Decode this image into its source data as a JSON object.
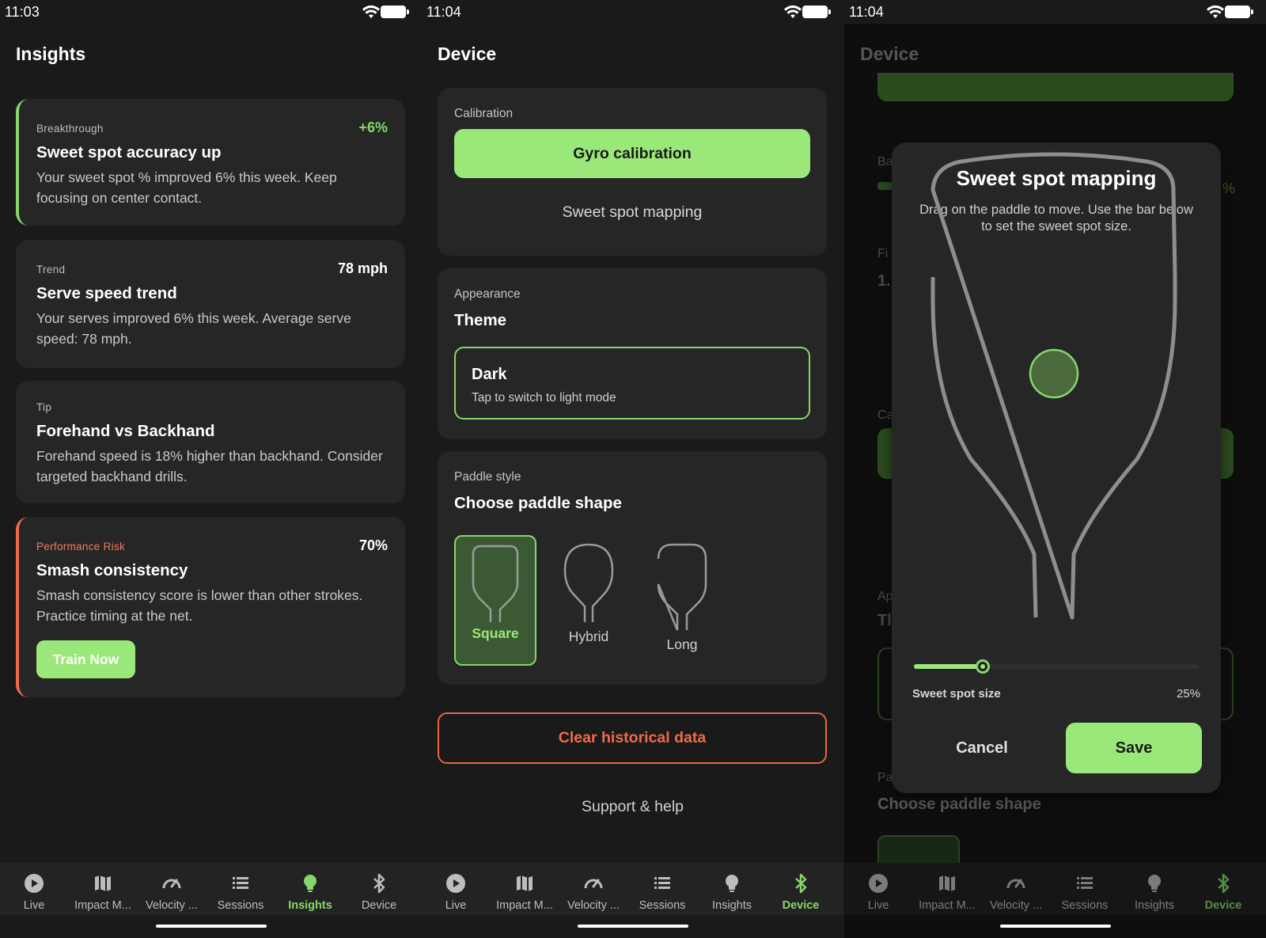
{
  "colors": {
    "accent": "#86d66a",
    "accent_button": "#9be87a",
    "danger": "#ef6b4b",
    "background": "#1a1a1a",
    "card": "#262626"
  },
  "screens": [
    {
      "time": "11:03",
      "title": "Insights",
      "cards": [
        {
          "category": "Breakthrough",
          "metric": "+6%",
          "title": "Sweet spot accuracy up",
          "description": "Your sweet spot % improved 6% this week. Keep focusing on center contact."
        },
        {
          "category": "Trend",
          "metric": "78 mph",
          "title": "Serve speed trend",
          "description": "Your serves improved 6% this week. Average serve speed: 78 mph."
        },
        {
          "category": "Tip",
          "metric": "",
          "title": "Forehand vs Backhand",
          "description": "Forehand speed is 18% higher than backhand. Consider targeted backhand drills."
        },
        {
          "category": "Performance Risk",
          "metric": "70%",
          "title": "Smash consistency",
          "description": "Smash consistency score is lower than other strokes. Practice timing at the net.",
          "action": "Train Now"
        }
      ]
    },
    {
      "time": "11:04",
      "title": "Device",
      "calibration": {
        "label": "Calibration",
        "gyro_button": "Gyro calibration",
        "sweet_spot_link": "Sweet spot mapping"
      },
      "appearance": {
        "label": "Appearance",
        "heading": "Theme",
        "value": "Dark",
        "hint": "Tap to switch to light mode"
      },
      "paddle": {
        "label": "Paddle style",
        "heading": "Choose paddle shape",
        "options": [
          "Square",
          "Hybrid",
          "Long"
        ],
        "selected": "Square"
      },
      "clear_button": "Clear historical data",
      "support_link": "Support & help"
    },
    {
      "time": "11:04",
      "title": "Device",
      "background_fragments": [
        "Ba",
        "%",
        "Fi",
        "1.",
        "Ca",
        "Ap",
        "Tl",
        "Pa"
      ],
      "background_heading": "Choose paddle shape",
      "modal": {
        "title": "Sweet spot mapping",
        "description": "Drag on the paddle to move. Use the bar below to set the sweet spot size.",
        "size_label": "Sweet spot size",
        "size_value": "25%",
        "size_fraction": 0.25,
        "cancel": "Cancel",
        "save": "Save"
      }
    }
  ],
  "nav": {
    "items": [
      {
        "label": "Live",
        "icon": "play-circle-icon"
      },
      {
        "label": "Impact M...",
        "icon": "map-icon"
      },
      {
        "label": "Velocity ...",
        "icon": "speedometer-icon"
      },
      {
        "label": "Sessions",
        "icon": "list-icon"
      },
      {
        "label": "Insights",
        "icon": "lightbulb-icon"
      },
      {
        "label": "Device",
        "icon": "bluetooth-icon"
      }
    ],
    "active_per_screen": [
      "Insights",
      "Device",
      "Device"
    ]
  }
}
